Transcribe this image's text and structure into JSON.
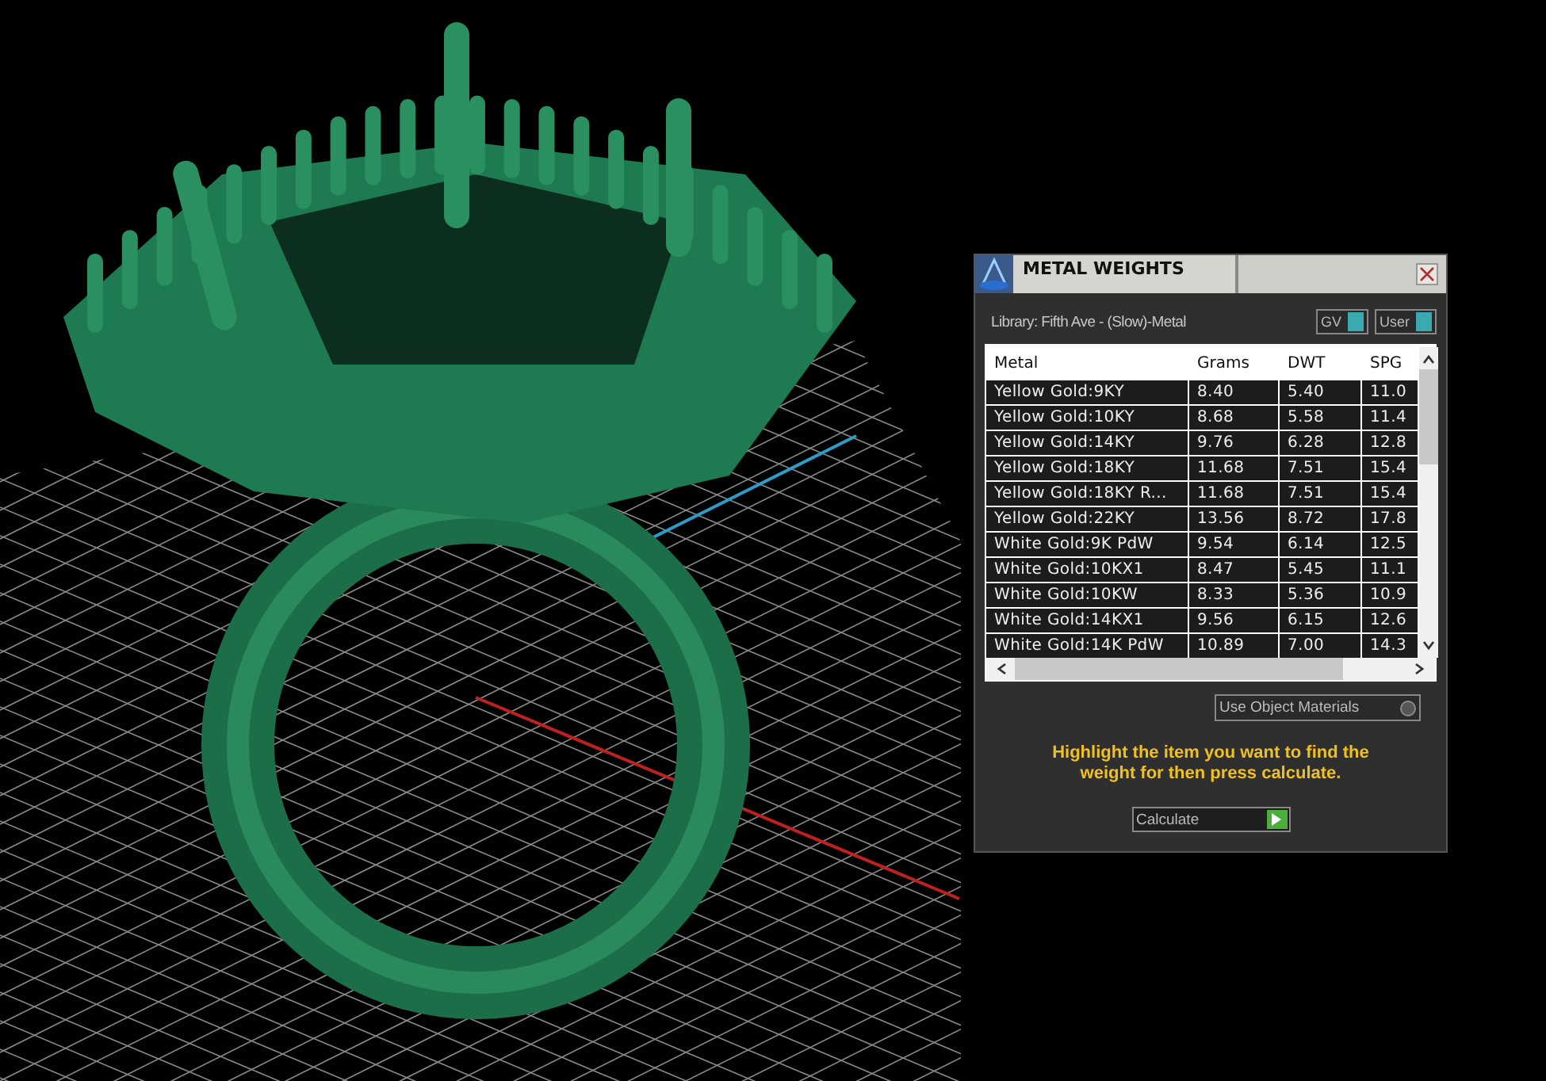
{
  "panel": {
    "title": "METAL WEIGHTS",
    "library": "Library: Fifth Ave - (Slow)-Metal",
    "toggles": [
      {
        "label": "GV",
        "on": true
      },
      {
        "label": "User",
        "on": true
      }
    ],
    "table": {
      "columns": [
        "Metal",
        "Grams",
        "DWT",
        "SPG"
      ],
      "rows": [
        [
          "Yellow Gold:9KY",
          "8.40",
          "5.40",
          "11.0"
        ],
        [
          "Yellow Gold:10KY",
          "8.68",
          "5.58",
          "11.4"
        ],
        [
          "Yellow Gold:14KY",
          "9.76",
          "6.28",
          "12.8"
        ],
        [
          "Yellow Gold:18KY",
          "11.68",
          "7.51",
          "15.4"
        ],
        [
          "Yellow Gold:18KY R...",
          "11.68",
          "7.51",
          "15.4"
        ],
        [
          "Yellow Gold:22KY",
          "13.56",
          "8.72",
          "17.8"
        ],
        [
          "White Gold:9K PdW",
          "9.54",
          "6.14",
          "12.5"
        ],
        [
          "White Gold:10KX1",
          "8.47",
          "5.45",
          "11.1"
        ],
        [
          "White Gold:10KW",
          "8.33",
          "5.36",
          "10.9"
        ],
        [
          "White Gold:14KX1",
          "9.56",
          "6.15",
          "12.6"
        ],
        [
          "White Gold:14K PdW",
          "10.89",
          "7.00",
          "14.3"
        ]
      ]
    },
    "use_object_materials": {
      "label": "Use Object Materials",
      "checked": false
    },
    "hint": "Highlight the item you want to find the weight for then press calculate.",
    "calculate_button": "Calculate"
  }
}
